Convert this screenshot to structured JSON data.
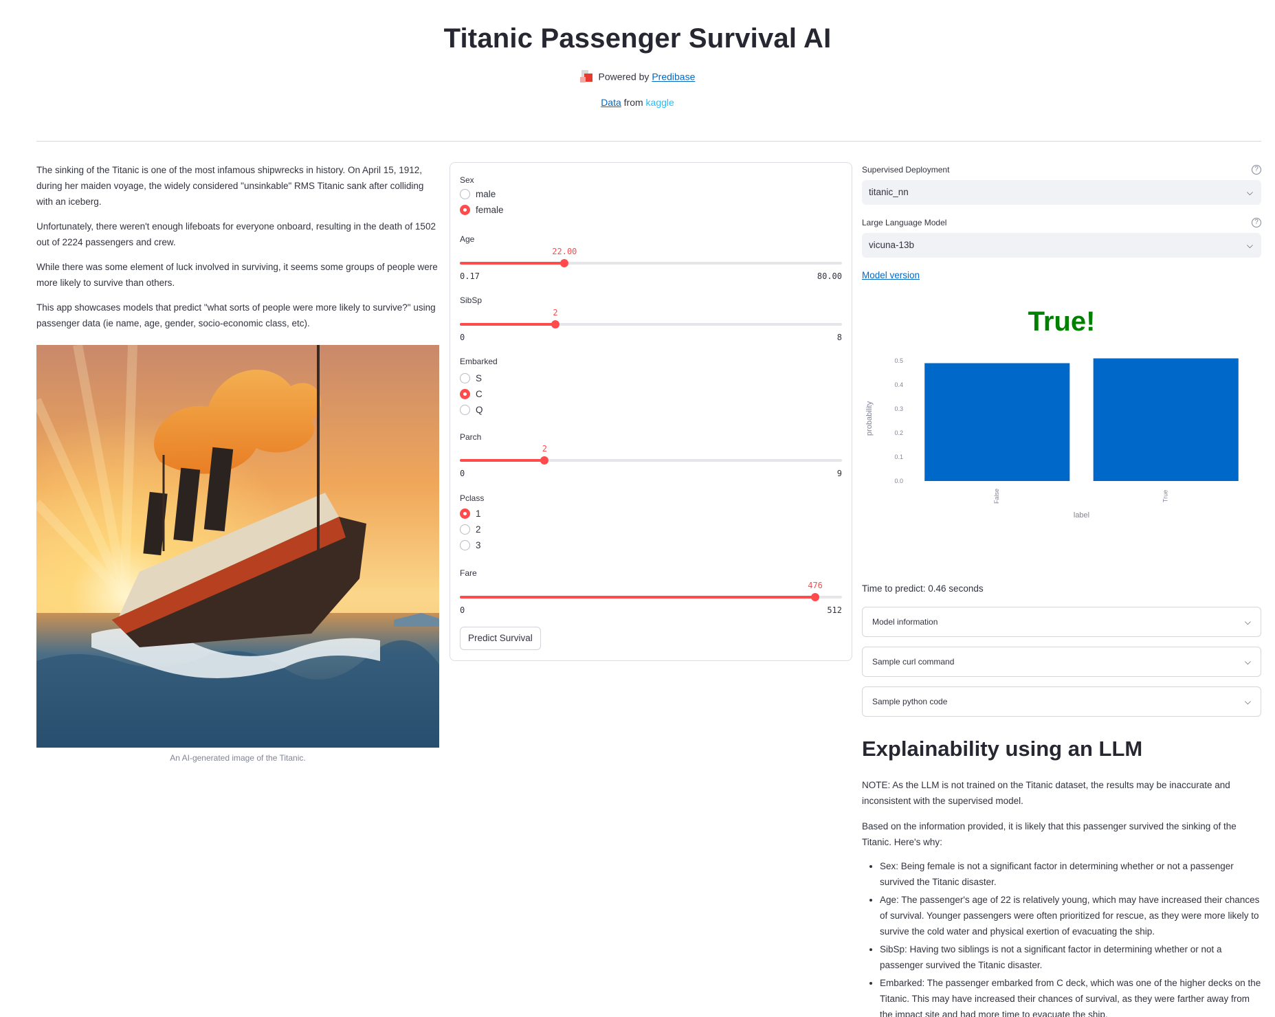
{
  "header": {
    "title": "Titanic Passenger Survival AI",
    "powered_by_prefix": "Powered by",
    "powered_by_link": "Predibase",
    "data_link": "Data",
    "data_from": "from",
    "kaggle": "kaggle"
  },
  "intro": {
    "paragraphs": [
      "The sinking of the Titanic is one of the most infamous shipwrecks in history. On April 15, 1912, during her maiden voyage, the widely considered \"unsinkable\" RMS Titanic sank after colliding with an iceberg.",
      "Unfortunately, there weren't enough lifeboats for everyone onboard, resulting in the death of 1502 out of 2224 passengers and crew.",
      "While there was some element of luck involved in surviving, it seems some groups of people were more likely to survive than others.",
      "This app showcases models that predict \"what sorts of people were more likely to survive?\" using passenger data (ie name, age, gender, socio-economic class, etc)."
    ],
    "image_caption": "An AI-generated image of the Titanic."
  },
  "form": {
    "sex": {
      "label": "Sex",
      "options": [
        "male",
        "female"
      ],
      "selected": "female"
    },
    "age": {
      "label": "Age",
      "value": "22.00",
      "min": "0.17",
      "max": "80.00",
      "fraction": 0.274
    },
    "sibsp": {
      "label": "SibSp",
      "value": "2",
      "min": "0",
      "max": "8",
      "fraction": 0.25
    },
    "embarked": {
      "label": "Embarked",
      "options": [
        "S",
        "C",
        "Q"
      ],
      "selected": "C"
    },
    "parch": {
      "label": "Parch",
      "value": "2",
      "min": "0",
      "max": "9",
      "fraction": 0.222
    },
    "pclass": {
      "label": "Pclass",
      "options": [
        "1",
        "2",
        "3"
      ],
      "selected": "1"
    },
    "fare": {
      "label": "Fare",
      "value": "476",
      "min": "0",
      "max": "512",
      "fraction": 0.93
    },
    "predict_button": "Predict Survival"
  },
  "model": {
    "deployment_label": "Supervised Deployment",
    "deployment_value": "titanic_nn",
    "llm_label": "Large Language Model",
    "llm_value": "vicuna-13b",
    "model_version_link": "Model version",
    "verdict": "True!",
    "time_to_predict": "Time to predict: 0.46 seconds",
    "expanders": [
      "Model information",
      "Sample curl command",
      "Sample python code"
    ]
  },
  "chart_data": {
    "type": "bar",
    "categories": [
      "False",
      "True"
    ],
    "values": [
      0.49,
      0.51
    ],
    "xlabel": "label",
    "ylabel": "probability",
    "yticks": [
      "0.0",
      "0.1",
      "0.2",
      "0.3",
      "0.4",
      "0.5"
    ],
    "ylim": [
      0,
      0.52
    ],
    "bar_color": "#0068c9",
    "grid": false
  },
  "explain": {
    "heading": "Explainability using an LLM",
    "note": "NOTE: As the LLM is not trained on the Titanic dataset, the results may be inaccurate and inconsistent with the supervised model.",
    "intro": "Based on the information provided, it is likely that this passenger survived the sinking of the Titanic. Here's why:",
    "bullets": [
      "Sex: Being female is not a significant factor in determining whether or not a passenger survived the Titanic disaster.",
      "Age: The passenger's age of 22 is relatively young, which may have increased their chances of survival. Younger passengers were often prioritized for rescue, as they were more likely to survive the cold water and physical exertion of evacuating the ship.",
      "SibSp: Having two siblings is not a significant factor in determining whether or not a passenger survived the Titanic disaster.",
      "Embarked: The passenger embarked from C deck, which was one of the higher decks on the Titanic. This may have increased their chances of survival, as they were farther away from the impact site and had more time to evacuate the ship."
    ]
  },
  "colors": {
    "accent": "#ff4b4b",
    "link": "#0068c9",
    "success": "#008000",
    "kaggle": "#20beff"
  }
}
